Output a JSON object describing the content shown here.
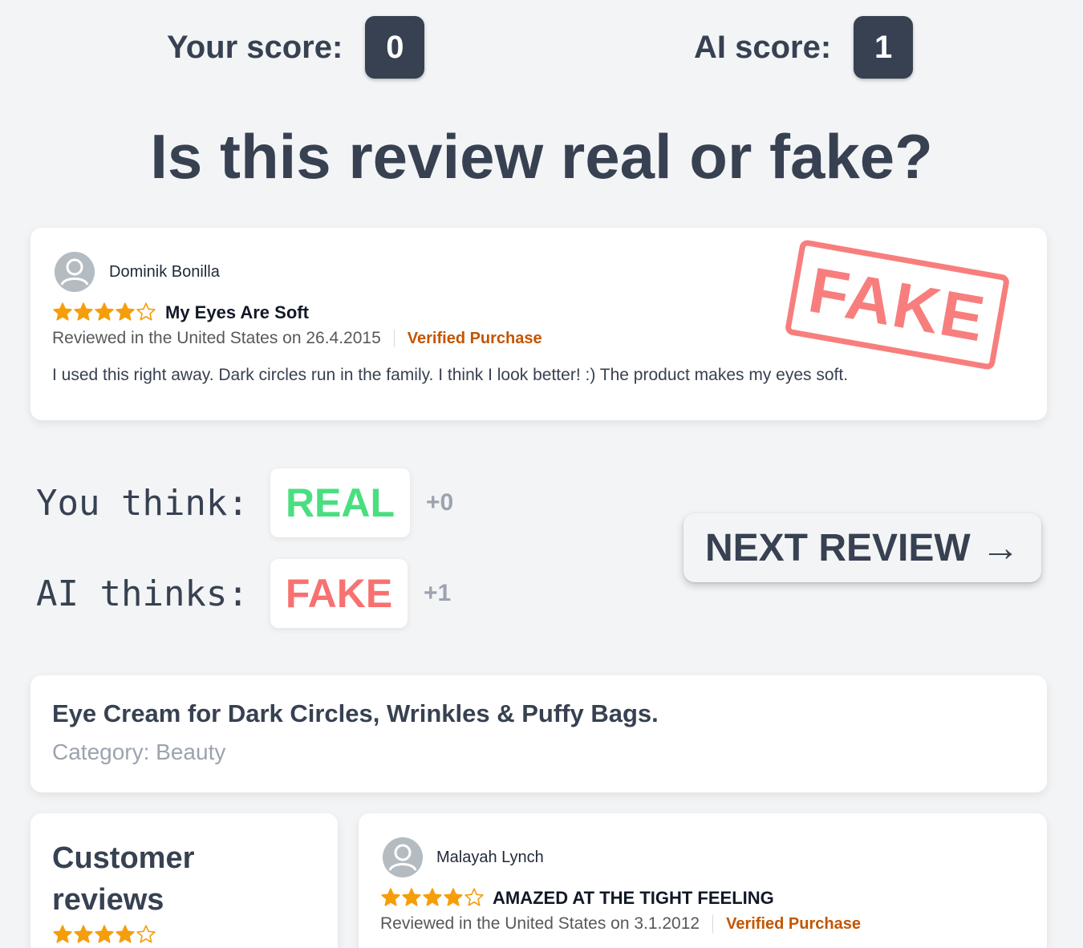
{
  "scores": {
    "you_label": "Your score:",
    "you_value": "0",
    "ai_label": "AI score:",
    "ai_value": "1"
  },
  "title": "Is this review real or fake?",
  "review": {
    "reviewer": "Dominik Bonilla",
    "rating": 4,
    "max_rating": 5,
    "title": "My Eyes Are Soft",
    "meta": "Reviewed in the United States on 26.4.2015",
    "verified": "Verified Purchase",
    "body": "I used this right away. Dark circles run in the family. I think I look better! :) The product makes my eyes soft.",
    "stamp": "FAKE"
  },
  "verdicts": {
    "you_label": "You think:",
    "you_value": "REAL",
    "you_points": "+0",
    "ai_label": "AI thinks:",
    "ai_value": "FAKE",
    "ai_points": "+1"
  },
  "next_button": "NEXT REVIEW →",
  "product": {
    "title": "Eye Cream for Dark Circles, Wrinkles & Puffy Bags.",
    "category": "Category: Beauty"
  },
  "summary": {
    "title": "Customer reviews",
    "rating": 4,
    "max_rating": 5
  },
  "other_review": {
    "reviewer": "Malayah Lynch",
    "rating": 4,
    "max_rating": 5,
    "title": "AMAZED AT THE TIGHT FEELING",
    "meta": "Reviewed in the United States on 3.1.2012",
    "verified": "Verified Purchase"
  },
  "colors": {
    "star": "#f59e0b",
    "real": "#4ade80",
    "fake": "#f87171",
    "verified": "#c45500",
    "dark": "#374151"
  }
}
